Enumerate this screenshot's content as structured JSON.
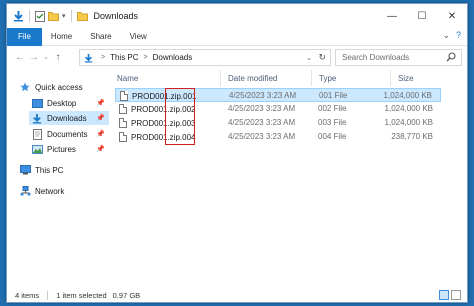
{
  "window": {
    "title": "Downloads",
    "controls": [
      "—",
      "☐",
      "✕"
    ]
  },
  "ribbon": {
    "tabs": [
      "File",
      "Home",
      "Share",
      "View"
    ]
  },
  "navbar": {
    "breadcrumb": [
      "This PC",
      "Downloads"
    ],
    "search_placeholder": "Search Downloads"
  },
  "navpane": {
    "quick_access_label": "Quick access",
    "items": [
      {
        "label": "Desktop",
        "icon": "desktop-icon",
        "pinned": true
      },
      {
        "label": "Downloads",
        "icon": "download-icon",
        "pinned": true,
        "selected": true
      },
      {
        "label": "Documents",
        "icon": "document-icon",
        "pinned": true
      },
      {
        "label": "Pictures",
        "icon": "picture-icon",
        "pinned": true
      }
    ],
    "this_pc_label": "This PC",
    "network_label": "Network"
  },
  "columns": [
    "Name",
    "Date modified",
    "Type",
    "Size"
  ],
  "files": [
    {
      "name": "PROD001.zip.001",
      "date": "4/25/2023 3:23 AM",
      "type": "001 File",
      "size": "1,024,000 KB",
      "selected": true
    },
    {
      "name": "PROD001.zip.002",
      "date": "4/25/2023 3:23 AM",
      "type": "002 File",
      "size": "1,024,000 KB"
    },
    {
      "name": "PROD001.zip.003",
      "date": "4/25/2023 3:23 AM",
      "type": "003 File",
      "size": "1,024,000 KB"
    },
    {
      "name": "PROD001.zip.004",
      "date": "4/25/2023 3:23 AM",
      "type": "004 File",
      "size": "238,770 KB"
    }
  ],
  "status": {
    "items": "4 items",
    "selection": "1 item selected",
    "selection_size": "0.97 GB"
  },
  "colors": {
    "accent": "#1979ca",
    "selection": "#cce8ff",
    "highlight_box": "#d02020"
  }
}
